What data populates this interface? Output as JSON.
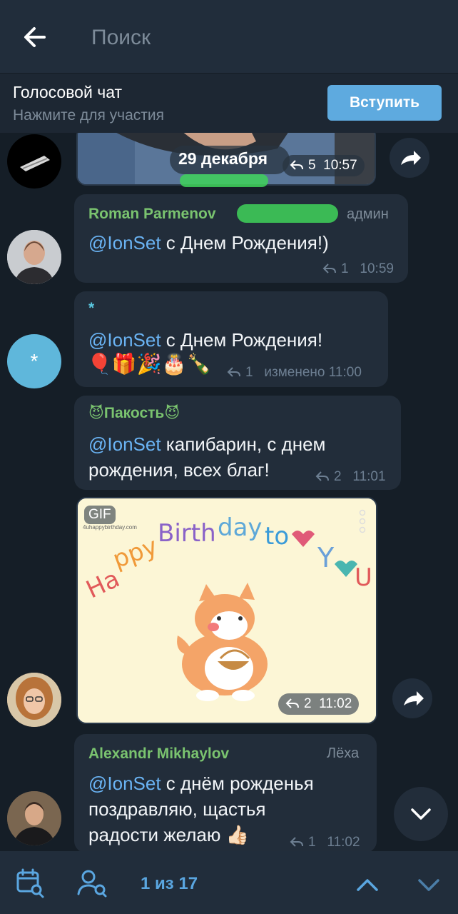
{
  "header": {
    "back_icon": "arrow-left-icon",
    "search_placeholder": "Поиск"
  },
  "voice_chat": {
    "title": "Голосовой чат",
    "subtitle": "Нажмите для участия",
    "join_label": "Вступить"
  },
  "messages": [
    {
      "kind": "photo",
      "date_badge": "29 декабря",
      "replies": "5",
      "time": "10:57"
    },
    {
      "kind": "text",
      "sender": "Roman Parmenov",
      "role": "админ",
      "mention": "@IonSet",
      "text": " с Днем Рождения!)",
      "replies": "1",
      "time": "10:59",
      "name_color": "#7ac36f"
    },
    {
      "kind": "text",
      "sender": "*",
      "avatar_letter": "*",
      "mention": "@IonSet",
      "text": " с Днем Рождения!",
      "emoji": "🎈🎁🎉🎂🍾",
      "replies": "1",
      "time": "изменено 11:00",
      "name_color": "#5ac8e0"
    },
    {
      "kind": "text",
      "sender": "😈Пакость😈",
      "mention": "@IonSet",
      "text_line1": " капибарин, с днем",
      "text_line2": "рождения, всех благ!",
      "replies": "2",
      "time": "11:01",
      "name_color": "#7ac36f"
    },
    {
      "kind": "gif",
      "badge": "GIF",
      "watermark": "4uhappybirthday.com",
      "caption_image_text": "Happy Birthday to YOU!",
      "replies": "2",
      "time": "11:02"
    },
    {
      "kind": "text",
      "sender": "Alexandr Mikhaylov",
      "role": "Лёха",
      "mention": "@IonSet",
      "text_line1": " с днём рожденья",
      "text_line2": "поздравляю, щастья",
      "text_line3": "радости желаю 👍🏻",
      "replies": "1",
      "time": "11:02",
      "name_color": "#7ac36f"
    }
  ],
  "bottom": {
    "calendar_icon": "calendar-search-icon",
    "user_search_icon": "user-search-icon",
    "counter": "1 из 17",
    "up_icon": "chevron-up-icon",
    "down_icon": "chevron-down-icon"
  },
  "colors": {
    "background": "#151e27",
    "bubble": "#222d3a",
    "accent": "#5eaadf",
    "mention": "#6ab3f3"
  }
}
